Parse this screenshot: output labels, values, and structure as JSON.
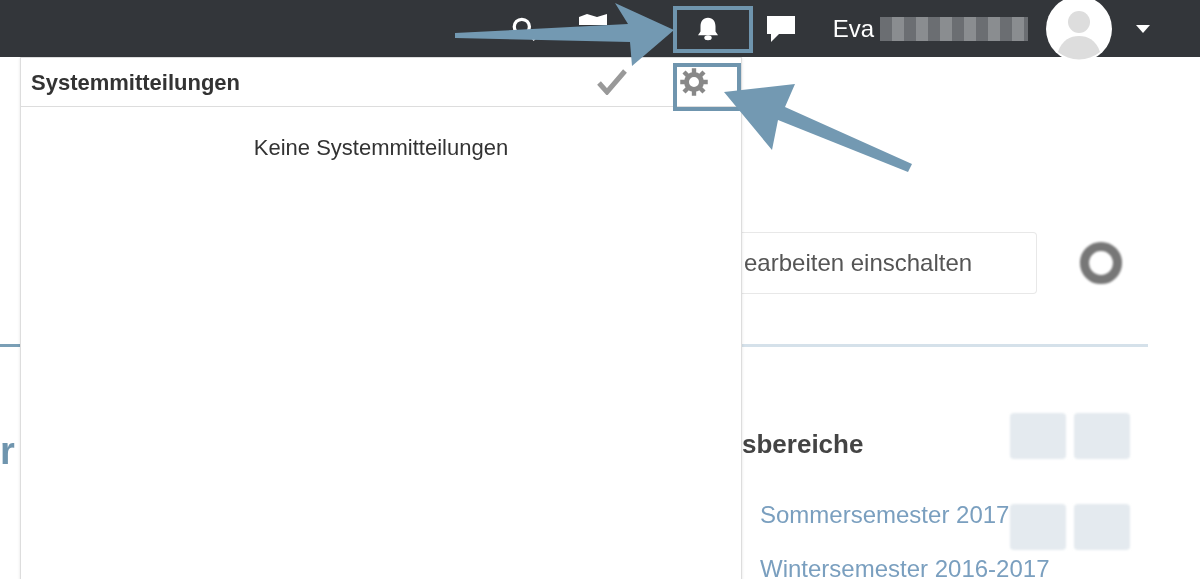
{
  "topbar": {
    "user_name": "Eva"
  },
  "page": {
    "edit_button": "earbeiten einschalten",
    "section_heading": "sbereiche",
    "links": [
      "Sommersemester 2017",
      "Wintersemester 2016-2017"
    ],
    "left_heading": "r"
  },
  "notifications_panel": {
    "title": "Systemmitteilungen",
    "empty_message": "Keine Systemmitteilungen"
  }
}
